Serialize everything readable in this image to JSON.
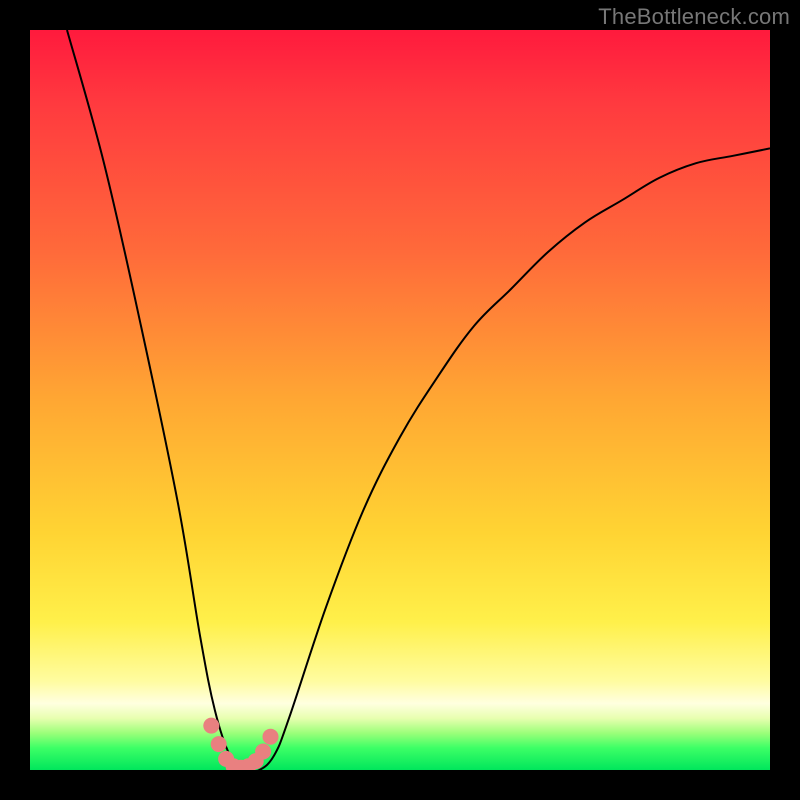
{
  "watermark": "TheBottleneck.com",
  "chart_data": {
    "type": "line",
    "title": "",
    "xlabel": "",
    "ylabel": "",
    "xlim": [
      0,
      100
    ],
    "ylim": [
      0,
      100
    ],
    "grid": false,
    "series": [
      {
        "name": "bottleneck-curve",
        "x": [
          5,
          10,
          15,
          20,
          23,
          25,
          27,
          29,
          31,
          33,
          35,
          40,
          45,
          50,
          55,
          60,
          65,
          70,
          75,
          80,
          85,
          90,
          95,
          100
        ],
        "y": [
          100,
          82,
          60,
          36,
          18,
          8,
          2,
          0,
          0,
          2,
          7,
          22,
          35,
          45,
          53,
          60,
          65,
          70,
          74,
          77,
          80,
          82,
          83,
          84
        ]
      }
    ],
    "markers": {
      "name": "highlight-dots",
      "color": "#e98080",
      "x": [
        24.5,
        25.5,
        26.5,
        27.5,
        28.5,
        29.5,
        30.5,
        31.5,
        32.5
      ],
      "y": [
        6.0,
        3.5,
        1.5,
        0.5,
        0.3,
        0.5,
        1.2,
        2.5,
        4.5
      ]
    },
    "background_gradient": {
      "top": "#ff1a3d",
      "mid": "#ffd433",
      "bottom": "#00e65c"
    }
  }
}
